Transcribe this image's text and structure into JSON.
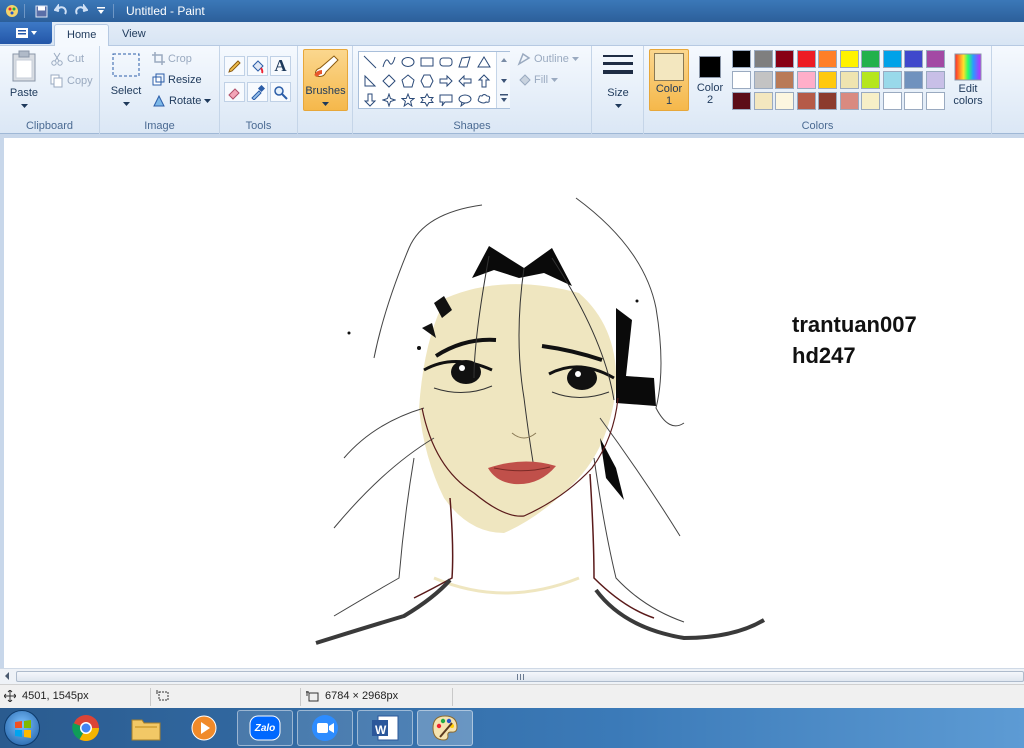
{
  "window": {
    "title": "Untitled - Paint"
  },
  "tabs": [
    {
      "label": "Home"
    },
    {
      "label": "View"
    }
  ],
  "clipboard": {
    "paste": "Paste",
    "cut": "Cut",
    "copy": "Copy",
    "group": "Clipboard"
  },
  "image": {
    "select": "Select",
    "crop": "Crop",
    "resize": "Resize",
    "rotate": "Rotate",
    "group": "Image"
  },
  "tools": {
    "group": "Tools",
    "text_tool": "A"
  },
  "brushes": {
    "label": "Brushes"
  },
  "shapes": {
    "outline": "Outline",
    "fill": "Fill",
    "group": "Shapes"
  },
  "size": {
    "label": "Size"
  },
  "colors": {
    "color1_line1": "Color",
    "color1_line2": "1",
    "color2_line1": "Color",
    "color2_line2": "2",
    "edit_line1": "Edit",
    "edit_line2": "colors",
    "group": "Colors",
    "color1_value": "#f3e7bf",
    "color2_value": "#000000",
    "palette_row1": [
      "#000000",
      "#7f7f7f",
      "#880015",
      "#ed1c24",
      "#ff7f27",
      "#fff200",
      "#22b14c",
      "#00a2e8",
      "#3f48cc",
      "#a349a4"
    ],
    "palette_row2": [
      "#ffffff",
      "#c3c3c3",
      "#b97a57",
      "#ffaec9",
      "#ffc90e",
      "#efe4b0",
      "#b5e61d",
      "#99d9ea",
      "#7092be",
      "#c8bfe7"
    ],
    "palette_row3": [
      "#5c0d18",
      "#f3e7bf",
      "#fcf6e0",
      "#b55a48",
      "#8c3b2e",
      "#d98a80",
      "#f7efc7",
      "#ffffff",
      "#ffffff",
      "#ffffff"
    ]
  },
  "canvas": {
    "text_line1": "trantuan007",
    "text_line2": "hd247"
  },
  "status": {
    "cursor_pos": "4501, 1545px",
    "image_size": "6784 × 2968px"
  },
  "taskbar": {
    "items": [
      "start-button",
      "chrome",
      "file-explorer",
      "media-player",
      "zalo",
      "zoom",
      "word",
      "paint"
    ],
    "zalo_label": "Zalo",
    "word_label": "W"
  }
}
